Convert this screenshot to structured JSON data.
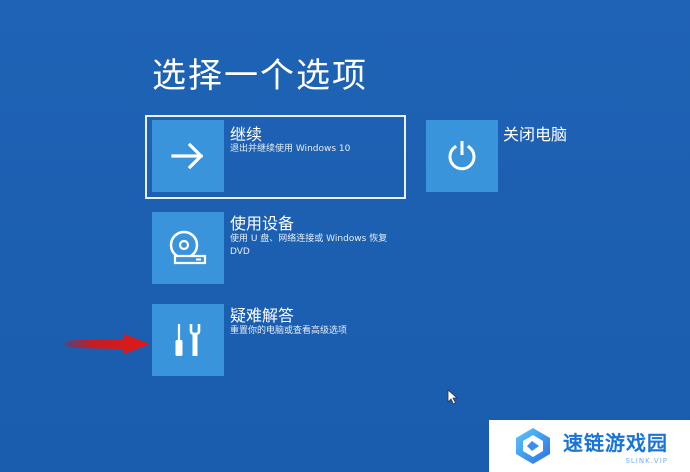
{
  "screen": {
    "title": "选择一个选项"
  },
  "options": {
    "continue": {
      "title": "继续",
      "description": "退出并继续使用 Windows 10"
    },
    "use_device": {
      "title": "使用设备",
      "description": "使用 U 盘、网络连接或 Windows 恢复 DVD"
    },
    "troubleshoot": {
      "title": "疑难解答",
      "description": "重置你的电脑或查看高级选项"
    },
    "shutdown": {
      "title": "关闭电脑"
    }
  },
  "watermark": {
    "name": "速链游戏园",
    "sub": "SLINK.VIP"
  },
  "colors": {
    "background": "#1a5fb4",
    "tile": "#3a94dc",
    "annotation_arrow": "#cc1010"
  }
}
